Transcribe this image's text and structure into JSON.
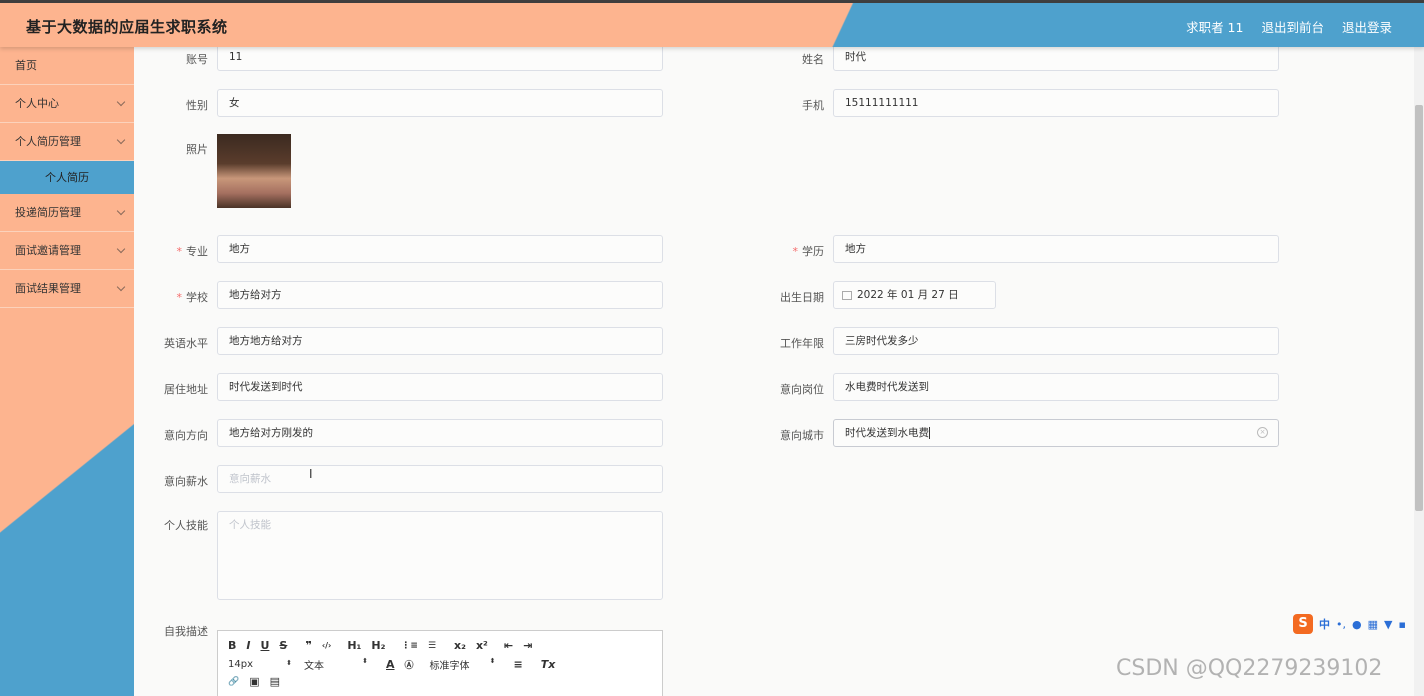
{
  "app": {
    "title": "基于大数据的应届生求职系统"
  },
  "header": {
    "user": "求职者 11",
    "front_link": "退出到前台",
    "logout": "退出登录"
  },
  "sidebar": {
    "items": [
      {
        "label": "首页"
      },
      {
        "label": "个人中心"
      },
      {
        "label": "个人简历管理"
      },
      {
        "label": "个人简历"
      },
      {
        "label": "投递简历管理"
      },
      {
        "label": "面试邀请管理"
      },
      {
        "label": "面试结果管理"
      }
    ]
  },
  "form": {
    "account": {
      "label": "账号",
      "value": "11"
    },
    "name": {
      "label": "姓名",
      "value": "时代"
    },
    "gender": {
      "label": "性别",
      "value": "女"
    },
    "phone": {
      "label": "手机",
      "value": "15111111111"
    },
    "photo": {
      "label": "照片"
    },
    "major": {
      "label": "专业",
      "value": "地方"
    },
    "education": {
      "label": "学历",
      "value": "地方"
    },
    "school": {
      "label": "学校",
      "value": "地方给对方"
    },
    "birthday": {
      "label": "出生日期",
      "value": "2022 年 01 月 27 日"
    },
    "english": {
      "label": "英语水平",
      "value": "地方地方给对方"
    },
    "work_years": {
      "label": "工作年限",
      "value": "三房时代发多少"
    },
    "address": {
      "label": "居住地址",
      "value": "时代发送到时代"
    },
    "position": {
      "label": "意向岗位",
      "value": "水电费时代发送到"
    },
    "direction": {
      "label": "意向方向",
      "value": "地方给对方刚发的"
    },
    "city": {
      "label": "意向城市",
      "value": "时代发送到水电费"
    },
    "salary": {
      "label": "意向薪水",
      "placeholder": "意向薪水"
    },
    "skills": {
      "label": "个人技能",
      "placeholder": "个人技能"
    },
    "self_desc": {
      "label": "自我描述"
    },
    "required_mark": "*"
  },
  "editor": {
    "toolbar1": [
      "B",
      "I",
      "U",
      "S",
      "❞",
      "‹/›",
      "H₁",
      "H₂",
      "⋮≡",
      "☰",
      "x₂",
      "x²",
      "⇤",
      "⇥"
    ],
    "font_size": "14px",
    "text_type": "文本",
    "font_family": "标准字体",
    "toolbar2_icons": [
      "A",
      "Ⓐ",
      "≡",
      "Tx"
    ],
    "toolbar3": [
      "🔗",
      "▣",
      "▤"
    ]
  },
  "ime": {
    "label": "中",
    "punct": "•,"
  },
  "watermark": "CSDN @QQ2279239102"
}
